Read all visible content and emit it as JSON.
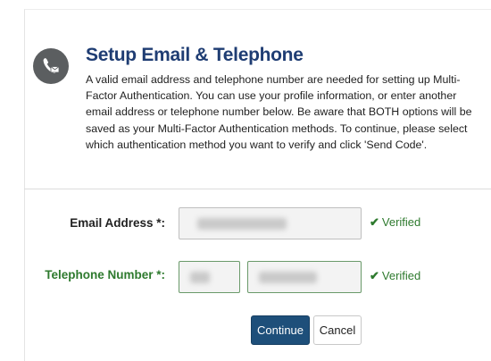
{
  "header": {
    "icon": "phone-email-icon",
    "title": "Setup Email & Telephone",
    "description": "A valid email address and telephone number are needed for setting up Multi-Factor Authentication. You can use your profile information, or enter another email address or telephone number below. Be aware that BOTH options will be saved as your Multi-Factor Authentication methods. To continue, please select which authentication method you want to verify and click 'Send Code'."
  },
  "form": {
    "email": {
      "label": "Email Address *:",
      "status": "Verified"
    },
    "phone": {
      "label": "Telephone Number *:",
      "status": "Verified"
    }
  },
  "buttons": {
    "continue": "Continue",
    "cancel": "Cancel"
  },
  "colors": {
    "title": "#1f3d73",
    "verified": "#2e7a2e",
    "primary_button": "#1e4f7a"
  }
}
